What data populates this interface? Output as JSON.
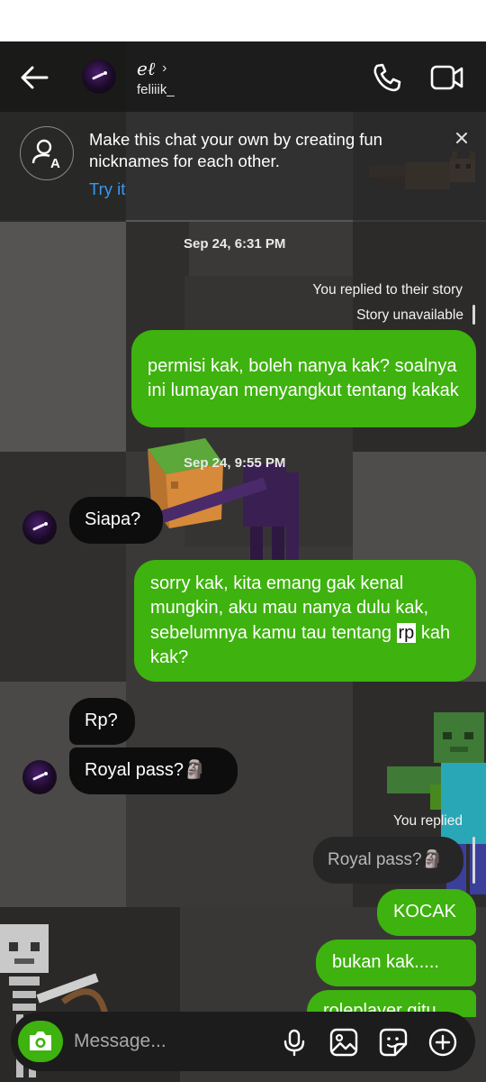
{
  "header": {
    "display_name": "eℓ",
    "username": "feliiik_",
    "icons": [
      "back-arrow-icon",
      "phone-icon",
      "video-camera-icon",
      "chevron-right-icon"
    ]
  },
  "banner": {
    "text": "Make this chat your own by creating fun nicknames for each other.",
    "action": "Try it",
    "icons": [
      "nickname-icon",
      "close-icon"
    ]
  },
  "thread": {
    "timestamp_1": "Sep 24, 6:31 PM",
    "story_reply_note": "You replied to their story",
    "story_unavailable": "Story unavailable",
    "msg_1": "permisi kak, boleh nanya kak? soalnya ini lumayan menyangkut tentang kakak",
    "timestamp_2": "Sep 24, 9:55 PM",
    "msg_2": "Siapa?",
    "msg_3_before": "sorry kak, kita emang gak kenal mungkin, aku mau nanya dulu kak, sebelumnya kamu tau tentang ",
    "msg_3_highlight": "rp",
    "msg_3_after": " kah kak?",
    "msg_4": "Rp?",
    "msg_5": "Royal pass?🗿",
    "replied_note": "You replied",
    "quoted": "Royal pass?🗿",
    "msg_6": "KOCAK",
    "msg_7": "bukan kak.....",
    "msg_8_partial": "roleplayer gitu"
  },
  "composer": {
    "placeholder": "Message...",
    "icons": [
      "camera-icon",
      "microphone-icon",
      "gallery-icon",
      "sticker-icon",
      "add-icon"
    ]
  },
  "colors": {
    "sent_bubble": "#3eb20e",
    "received_bubble": "#0d0d0d",
    "link": "#3897f0",
    "background": "#3a3938"
  }
}
